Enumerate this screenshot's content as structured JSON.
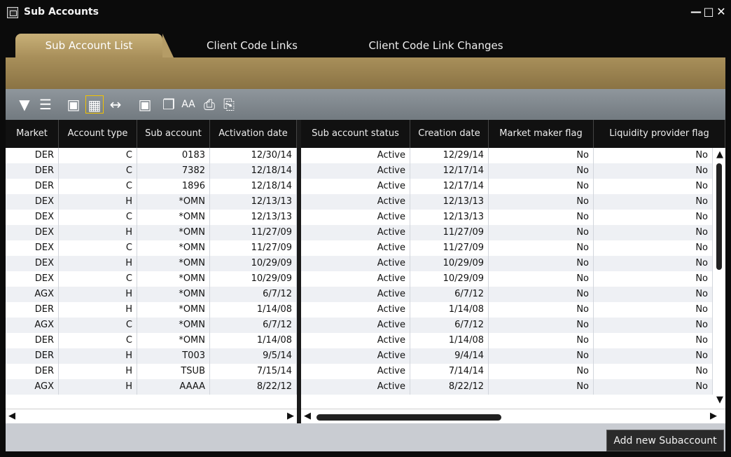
{
  "window": {
    "title": "Sub Accounts"
  },
  "tabs": [
    {
      "label": "Sub Account List",
      "active": true
    },
    {
      "label": "Client Code Links",
      "active": false
    },
    {
      "label": "Client Code Link Changes",
      "active": false
    }
  ],
  "toolbar": {
    "icons": [
      "filter-icon",
      "list-icon",
      "save-icon",
      "columns-icon",
      "fit-width-icon",
      "copy-icon",
      "copy-all-icon",
      "font-size-icon",
      "print-icon",
      "export-icon"
    ]
  },
  "columns": [
    "Market",
    "Account type",
    "Sub account",
    "Activation date",
    "Sub account status",
    "Creation date",
    "Market maker flag",
    "Liquidity provider flag"
  ],
  "rows": [
    [
      "DER",
      "C",
      "0183",
      "12/30/14",
      "Active",
      "12/29/14",
      "No",
      "No"
    ],
    [
      "DER",
      "C",
      "7382",
      "12/18/14",
      "Active",
      "12/17/14",
      "No",
      "No"
    ],
    [
      "DER",
      "C",
      "1896",
      "12/18/14",
      "Active",
      "12/17/14",
      "No",
      "No"
    ],
    [
      "DEX",
      "H",
      "*OMN",
      "12/13/13",
      "Active",
      "12/13/13",
      "No",
      "No"
    ],
    [
      "DEX",
      "C",
      "*OMN",
      "12/13/13",
      "Active",
      "12/13/13",
      "No",
      "No"
    ],
    [
      "DEX",
      "H",
      "*OMN",
      "11/27/09",
      "Active",
      "11/27/09",
      "No",
      "No"
    ],
    [
      "DEX",
      "C",
      "*OMN",
      "11/27/09",
      "Active",
      "11/27/09",
      "No",
      "No"
    ],
    [
      "DEX",
      "H",
      "*OMN",
      "10/29/09",
      "Active",
      "10/29/09",
      "No",
      "No"
    ],
    [
      "DEX",
      "C",
      "*OMN",
      "10/29/09",
      "Active",
      "10/29/09",
      "No",
      "No"
    ],
    [
      "AGX",
      "H",
      "*OMN",
      "6/7/12",
      "Active",
      "6/7/12",
      "No",
      "No"
    ],
    [
      "DER",
      "H",
      "*OMN",
      "1/14/08",
      "Active",
      "1/14/08",
      "No",
      "No"
    ],
    [
      "AGX",
      "C",
      "*OMN",
      "6/7/12",
      "Active",
      "6/7/12",
      "No",
      "No"
    ],
    [
      "DER",
      "C",
      "*OMN",
      "1/14/08",
      "Active",
      "1/14/08",
      "No",
      "No"
    ],
    [
      "DER",
      "H",
      "T003",
      "9/5/14",
      "Active",
      "9/4/14",
      "No",
      "No"
    ],
    [
      "DER",
      "H",
      "TSUB",
      "7/15/14",
      "Active",
      "7/14/14",
      "No",
      "No"
    ],
    [
      "AGX",
      "H",
      "AAAA",
      "8/22/12",
      "Active",
      "8/22/12",
      "No",
      "No"
    ]
  ],
  "footer": {
    "add_button_label": "Add new Subaccount"
  }
}
